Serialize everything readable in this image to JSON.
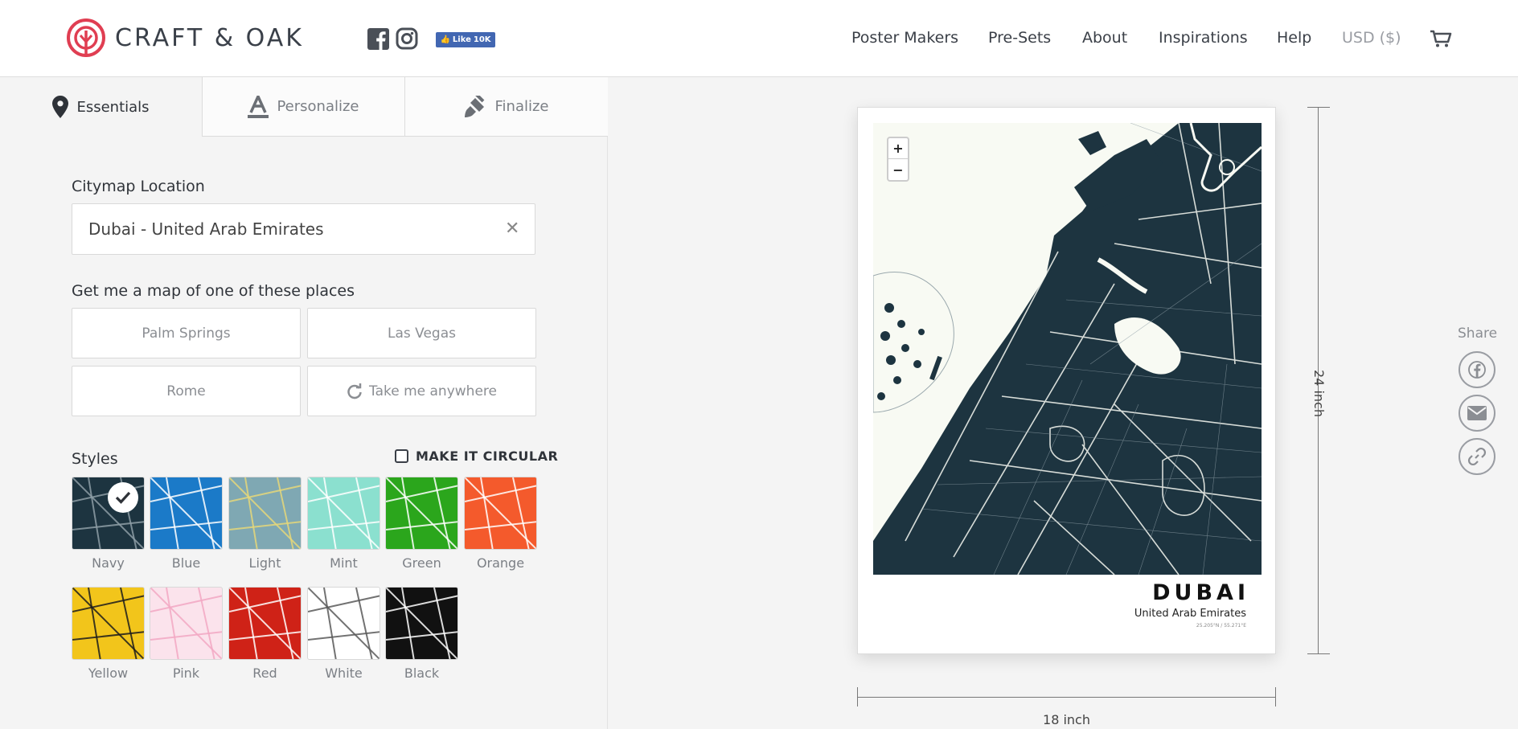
{
  "brand": {
    "name": "CRAFT & OAK",
    "accent": "#e03e52"
  },
  "social": {
    "icons": [
      "facebook-icon",
      "instagram-icon"
    ],
    "like_label": "Like",
    "like_count": "10K"
  },
  "nav": {
    "items": [
      "Poster Makers",
      "Pre-Sets",
      "About",
      "Inspirations",
      "Help"
    ],
    "currency": "USD ($)"
  },
  "tabs": [
    {
      "label": "Essentials",
      "icon": "map-pin-icon",
      "active": true
    },
    {
      "label": "Personalize",
      "icon": "text-format-icon",
      "active": false
    },
    {
      "label": "Finalize",
      "icon": "paintbrush-icon",
      "active": false
    }
  ],
  "location": {
    "label": "Citymap Location",
    "value": "Dubai - United Arab Emirates"
  },
  "places": {
    "label": "Get me a map of one of these places",
    "items": [
      "Palm Springs",
      "Las Vegas",
      "Rome",
      "Take me anywhere"
    ]
  },
  "styles": {
    "label": "Styles",
    "circular_label": "MAKE IT CIRCULAR",
    "circular_checked": false,
    "selected": "Navy",
    "items": [
      {
        "name": "Navy",
        "bg": "#1d3440",
        "fg": "#8e9ea6"
      },
      {
        "name": "Blue",
        "bg": "#1b7ac8",
        "fg": "#ffffff"
      },
      {
        "name": "Light",
        "bg": "#7fa8b3",
        "fg": "#e6d87a"
      },
      {
        "name": "Mint",
        "bg": "#8be0cf",
        "fg": "#ffffff"
      },
      {
        "name": "Green",
        "bg": "#2ba61c",
        "fg": "#ffffff"
      },
      {
        "name": "Orange",
        "bg": "#f45a2c",
        "fg": "#ffffff"
      },
      {
        "name": "Yellow",
        "bg": "#f2c51b",
        "fg": "#1d1d1d"
      },
      {
        "name": "Pink",
        "bg": "#fbe3ec",
        "fg": "#f2a8c4"
      },
      {
        "name": "Red",
        "bg": "#cf2217",
        "fg": "#ffffff"
      },
      {
        "name": "White",
        "bg": "#ffffff",
        "fg": "#5a5a5a"
      },
      {
        "name": "Black",
        "bg": "#111111",
        "fg": "#ffffff"
      }
    ]
  },
  "poster": {
    "city": "DUBAI",
    "country": "United Arab Emirates",
    "coords": "25.205°N / 55.271°E",
    "map_water": "#f8faf3",
    "map_land": "#1d3440",
    "zoom_in": "+",
    "zoom_out": "−"
  },
  "dimensions": {
    "height": "24 inch",
    "width": "18 inch"
  },
  "share": {
    "label": "Share",
    "icons": [
      "facebook-icon",
      "email-icon",
      "link-icon"
    ]
  }
}
